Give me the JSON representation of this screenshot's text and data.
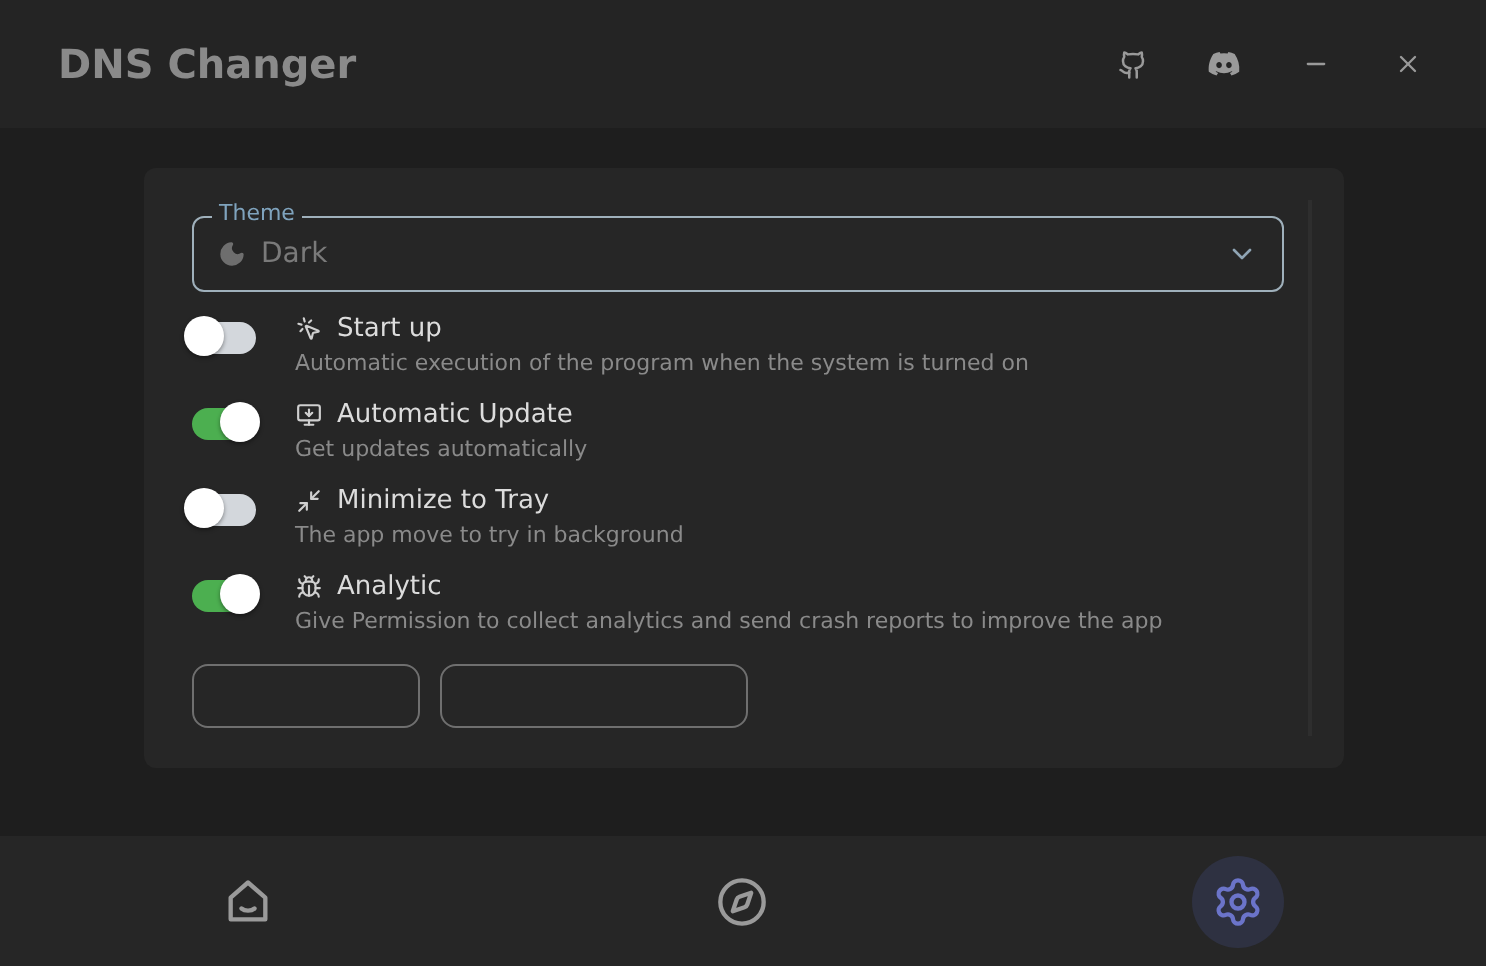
{
  "window": {
    "title": "DNS Changer"
  },
  "theme_select": {
    "label": "Theme",
    "value": "Dark"
  },
  "settings": [
    {
      "kind": "startup",
      "title": "Start up",
      "description": "Automatic execution of the program when the system is turned on",
      "on": false
    },
    {
      "kind": "update",
      "title": "Automatic Update",
      "description": "Get updates automatically",
      "on": true
    },
    {
      "kind": "tray",
      "title": "Minimize to Tray",
      "description": "The app move to try in background",
      "on": false
    },
    {
      "kind": "analytic",
      "title": "Analytic",
      "description": "Give Permission to collect analytics and send crash reports to improve the app",
      "on": true
    }
  ],
  "nav": [
    {
      "kind": "home",
      "selected": false
    },
    {
      "kind": "explore",
      "selected": false
    },
    {
      "kind": "settings",
      "selected": true
    }
  ]
}
